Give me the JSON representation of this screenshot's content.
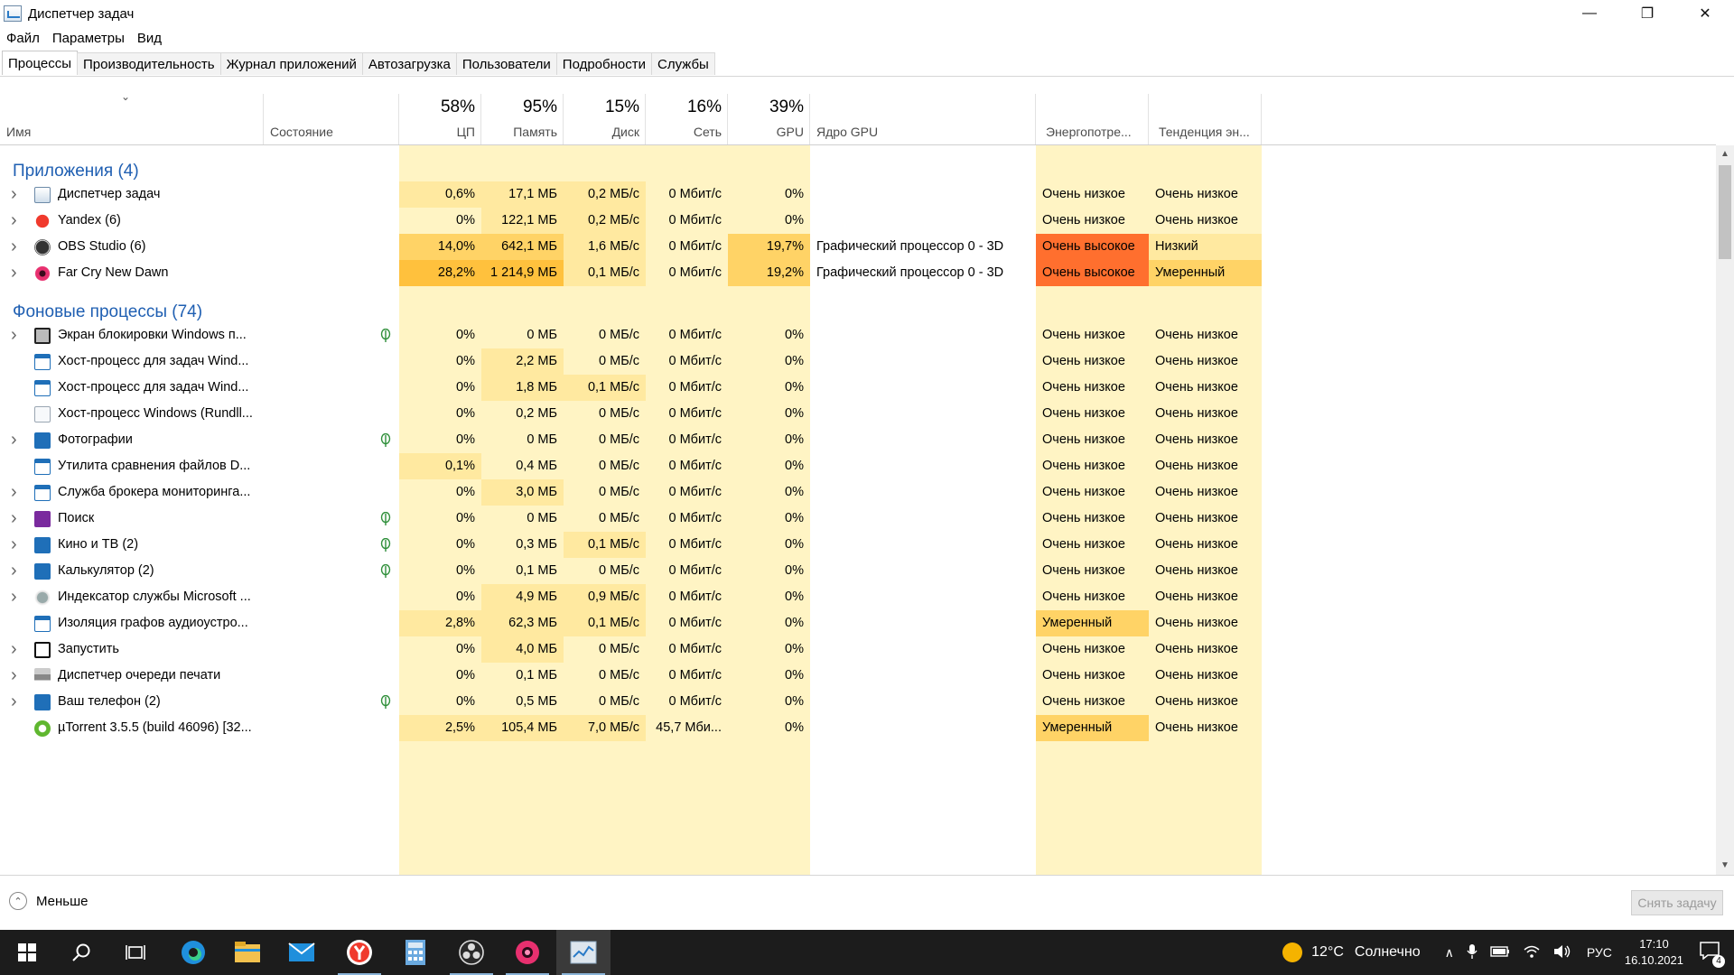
{
  "window": {
    "title": "Диспетчер задач",
    "minimize": "—",
    "restore": "❐",
    "close": "✕"
  },
  "menu": [
    "Файл",
    "Параметры",
    "Вид"
  ],
  "tabs": [
    "Процессы",
    "Производительность",
    "Журнал приложений",
    "Автозагрузка",
    "Пользователи",
    "Подробности",
    "Службы"
  ],
  "active_tab": 0,
  "columns": {
    "name": "Имя",
    "status": "Состояние",
    "cpu": {
      "pct": "58%",
      "label": "ЦП"
    },
    "mem": {
      "pct": "95%",
      "label": "Память"
    },
    "disk": {
      "pct": "15%",
      "label": "Диск"
    },
    "net": {
      "pct": "16%",
      "label": "Сеть"
    },
    "gpu": {
      "pct": "39%",
      "label": "GPU"
    },
    "gpu_engine": "Ядро GPU",
    "power": "Энергопотре...",
    "power_trend": "Тенденция эн..."
  },
  "sort_indicator": "⌄",
  "groups": [
    {
      "label": "Приложения (4)",
      "rows": [
        {
          "name": "Диспетчер задач",
          "icon": "task-manager-icon",
          "expand": true,
          "leaf": false,
          "cpu": "0,6%",
          "mem": "17,1 МБ",
          "disk": "0,2 МБ/с",
          "net": "0 Мбит/с",
          "gpu": "0%",
          "engine": "",
          "power": "Очень низкое",
          "trend": "Очень низкое",
          "heat": {
            "cpu": 1,
            "mem": 1,
            "disk": 1,
            "gpu": 0,
            "power": 0,
            "trend": 0
          }
        },
        {
          "name": "Yandex (6)",
          "icon": "yandex-icon",
          "expand": true,
          "leaf": false,
          "cpu": "0%",
          "mem": "122,1 МБ",
          "disk": "0,2 МБ/с",
          "net": "0 Мбит/с",
          "gpu": "0%",
          "engine": "",
          "power": "Очень низкое",
          "trend": "Очень низкое",
          "heat": {
            "cpu": 0,
            "mem": 1,
            "disk": 1,
            "gpu": 0,
            "power": 0,
            "trend": 0
          }
        },
        {
          "name": "OBS Studio (6)",
          "icon": "obs-icon",
          "expand": true,
          "leaf": false,
          "cpu": "14,0%",
          "mem": "642,1 МБ",
          "disk": "1,6 МБ/с",
          "net": "0 Мбит/с",
          "gpu": "19,7%",
          "engine": "Графический процессор 0 - 3D",
          "power": "Очень высокое",
          "trend": "Низкий",
          "heat": {
            "cpu": 2,
            "mem": 2,
            "disk": 1,
            "gpu": 2,
            "power": 4,
            "trend": 1
          }
        },
        {
          "name": "Far Cry New Dawn",
          "icon": "farcry-icon",
          "expand": true,
          "leaf": false,
          "cpu": "28,2%",
          "mem": "1 214,9 МБ",
          "disk": "0,1 МБ/с",
          "net": "0 Мбит/с",
          "gpu": "19,2%",
          "engine": "Графический процессор 0 - 3D",
          "power": "Очень высокое",
          "trend": "Умеренный",
          "heat": {
            "cpu": 3,
            "mem": 3,
            "disk": 1,
            "gpu": 2,
            "power": 4,
            "trend": 2
          }
        }
      ]
    },
    {
      "label": "Фоновые процессы (74)",
      "rows": [
        {
          "name": "Экран блокировки Windows п...",
          "icon": "lockscreen-icon",
          "expand": true,
          "leaf": true,
          "cpu": "0%",
          "mem": "0 МБ",
          "disk": "0 МБ/с",
          "net": "0 Мбит/с",
          "gpu": "0%",
          "engine": "",
          "power": "Очень низкое",
          "trend": "Очень низкое",
          "heat": {
            "cpu": 0,
            "mem": 0,
            "disk": 0,
            "gpu": 0,
            "power": 0,
            "trend": 0
          }
        },
        {
          "name": "Хост-процесс для задач Wind...",
          "icon": "window-app-icon",
          "expand": false,
          "leaf": false,
          "cpu": "0%",
          "mem": "2,2 МБ",
          "disk": "0 МБ/с",
          "net": "0 Мбит/с",
          "gpu": "0%",
          "engine": "",
          "power": "Очень низкое",
          "trend": "Очень низкое",
          "heat": {
            "cpu": 0,
            "mem": 1,
            "disk": 0,
            "gpu": 0,
            "power": 0,
            "trend": 0
          }
        },
        {
          "name": "Хост-процесс для задач Wind...",
          "icon": "window-app-icon",
          "expand": false,
          "leaf": false,
          "cpu": "0%",
          "mem": "1,8 МБ",
          "disk": "0,1 МБ/с",
          "net": "0 Мбит/с",
          "gpu": "0%",
          "engine": "",
          "power": "Очень низкое",
          "trend": "Очень низкое",
          "heat": {
            "cpu": 0,
            "mem": 1,
            "disk": 1,
            "gpu": 0,
            "power": 0,
            "trend": 0
          }
        },
        {
          "name": "Хост-процесс Windows (Rundll...",
          "icon": "blank-doc-icon",
          "expand": false,
          "leaf": false,
          "cpu": "0%",
          "mem": "0,2 МБ",
          "disk": "0 МБ/с",
          "net": "0 Мбит/с",
          "gpu": "0%",
          "engine": "",
          "power": "Очень низкое",
          "trend": "Очень низкое",
          "heat": {
            "cpu": 0,
            "mem": 0,
            "disk": 0,
            "gpu": 0,
            "power": 0,
            "trend": 0
          }
        },
        {
          "name": "Фотографии",
          "icon": "photos-icon",
          "expand": true,
          "leaf": true,
          "cpu": "0%",
          "mem": "0 МБ",
          "disk": "0 МБ/с",
          "net": "0 Мбит/с",
          "gpu": "0%",
          "engine": "",
          "power": "Очень низкое",
          "trend": "Очень низкое",
          "heat": {
            "cpu": 0,
            "mem": 0,
            "disk": 0,
            "gpu": 0,
            "power": 0,
            "trend": 0
          }
        },
        {
          "name": "Утилита сравнения файлов D...",
          "icon": "window-app-icon",
          "expand": false,
          "leaf": false,
          "cpu": "0,1%",
          "mem": "0,4 МБ",
          "disk": "0 МБ/с",
          "net": "0 Мбит/с",
          "gpu": "0%",
          "engine": "",
          "power": "Очень низкое",
          "trend": "Очень низкое",
          "heat": {
            "cpu": 1,
            "mem": 0,
            "disk": 0,
            "gpu": 0,
            "power": 0,
            "trend": 0
          }
        },
        {
          "name": "Служба брокера мониторинга...",
          "icon": "window-app-icon",
          "expand": true,
          "leaf": false,
          "cpu": "0%",
          "mem": "3,0 МБ",
          "disk": "0 МБ/с",
          "net": "0 Мбит/с",
          "gpu": "0%",
          "engine": "",
          "power": "Очень низкое",
          "trend": "Очень низкое",
          "heat": {
            "cpu": 0,
            "mem": 1,
            "disk": 0,
            "gpu": 0,
            "power": 0,
            "trend": 0
          }
        },
        {
          "name": "Поиск",
          "icon": "search-app-icon",
          "expand": true,
          "leaf": true,
          "cpu": "0%",
          "mem": "0 МБ",
          "disk": "0 МБ/с",
          "net": "0 Мбит/с",
          "gpu": "0%",
          "engine": "",
          "power": "Очень низкое",
          "trend": "Очень низкое",
          "heat": {
            "cpu": 0,
            "mem": 0,
            "disk": 0,
            "gpu": 0,
            "power": 0,
            "trend": 0
          }
        },
        {
          "name": "Кино и ТВ (2)",
          "icon": "movies-icon",
          "expand": true,
          "leaf": true,
          "cpu": "0%",
          "mem": "0,3 МБ",
          "disk": "0,1 МБ/с",
          "net": "0 Мбит/с",
          "gpu": "0%",
          "engine": "",
          "power": "Очень низкое",
          "trend": "Очень низкое",
          "heat": {
            "cpu": 0,
            "mem": 0,
            "disk": 1,
            "gpu": 0,
            "power": 0,
            "trend": 0
          }
        },
        {
          "name": "Калькулятор (2)",
          "icon": "calculator-icon",
          "expand": true,
          "leaf": true,
          "cpu": "0%",
          "mem": "0,1 МБ",
          "disk": "0 МБ/с",
          "net": "0 Мбит/с",
          "gpu": "0%",
          "engine": "",
          "power": "Очень низкое",
          "trend": "Очень низкое",
          "heat": {
            "cpu": 0,
            "mem": 0,
            "disk": 0,
            "gpu": 0,
            "power": 0,
            "trend": 0
          }
        },
        {
          "name": "Индексатор службы Microsoft ...",
          "icon": "indexer-icon",
          "expand": true,
          "leaf": false,
          "cpu": "0%",
          "mem": "4,9 МБ",
          "disk": "0,9 МБ/с",
          "net": "0 Мбит/с",
          "gpu": "0%",
          "engine": "",
          "power": "Очень низкое",
          "trend": "Очень низкое",
          "heat": {
            "cpu": 0,
            "mem": 1,
            "disk": 1,
            "gpu": 0,
            "power": 0,
            "trend": 0
          }
        },
        {
          "name": "Изоляция графов аудиоустро...",
          "icon": "window-app-icon",
          "expand": false,
          "leaf": false,
          "cpu": "2,8%",
          "mem": "62,3 МБ",
          "disk": "0,1 МБ/с",
          "net": "0 Мбит/с",
          "gpu": "0%",
          "engine": "",
          "power": "Умеренный",
          "trend": "Очень низкое",
          "heat": {
            "cpu": 1,
            "mem": 1,
            "disk": 1,
            "gpu": 0,
            "power": 2,
            "trend": 0
          }
        },
        {
          "name": "Запустить",
          "icon": "run-icon",
          "expand": true,
          "leaf": false,
          "cpu": "0%",
          "mem": "4,0 МБ",
          "disk": "0 МБ/с",
          "net": "0 Мбит/с",
          "gpu": "0%",
          "engine": "",
          "power": "Очень низкое",
          "trend": "Очень низкое",
          "heat": {
            "cpu": 0,
            "mem": 1,
            "disk": 0,
            "gpu": 0,
            "power": 0,
            "trend": 0
          }
        },
        {
          "name": "Диспетчер очереди печати",
          "icon": "printer-icon",
          "expand": true,
          "leaf": false,
          "cpu": "0%",
          "mem": "0,1 МБ",
          "disk": "0 МБ/с",
          "net": "0 Мбит/с",
          "gpu": "0%",
          "engine": "",
          "power": "Очень низкое",
          "trend": "Очень низкое",
          "heat": {
            "cpu": 0,
            "mem": 0,
            "disk": 0,
            "gpu": 0,
            "power": 0,
            "trend": 0
          }
        },
        {
          "name": "Ваш телефон (2)",
          "icon": "phone-app-icon",
          "expand": true,
          "leaf": true,
          "cpu": "0%",
          "mem": "0,5 МБ",
          "disk": "0 МБ/с",
          "net": "0 Мбит/с",
          "gpu": "0%",
          "engine": "",
          "power": "Очень низкое",
          "trend": "Очень низкое",
          "heat": {
            "cpu": 0,
            "mem": 0,
            "disk": 0,
            "gpu": 0,
            "power": 0,
            "trend": 0
          }
        },
        {
          "name": "µTorrent 3.5.5  (build 46096) [32...",
          "icon": "utorrent-icon",
          "expand": false,
          "leaf": false,
          "cpu": "2,5%",
          "mem": "105,4 МБ",
          "disk": "7,0 МБ/с",
          "net": "45,7 Мби...",
          "gpu": "0%",
          "engine": "",
          "power": "Умеренный",
          "trend": "Очень низкое",
          "heat": {
            "cpu": 1,
            "mem": 1,
            "disk": 1,
            "gpu": 0,
            "power": 2,
            "trend": 0
          }
        }
      ]
    }
  ],
  "heat_colors": [
    "#fff4c4",
    "#ffe9a0",
    "#ffd366",
    "#ffc13d",
    "#ff6f2e"
  ],
  "footer": {
    "less_label": "Меньше",
    "end_task_label": "Снять задачу"
  },
  "taskbar": {
    "temperature": "12°C",
    "weather": "Солнечно",
    "language": "РУС",
    "time": "17:10",
    "date": "16.10.2021",
    "notifications": "4"
  }
}
